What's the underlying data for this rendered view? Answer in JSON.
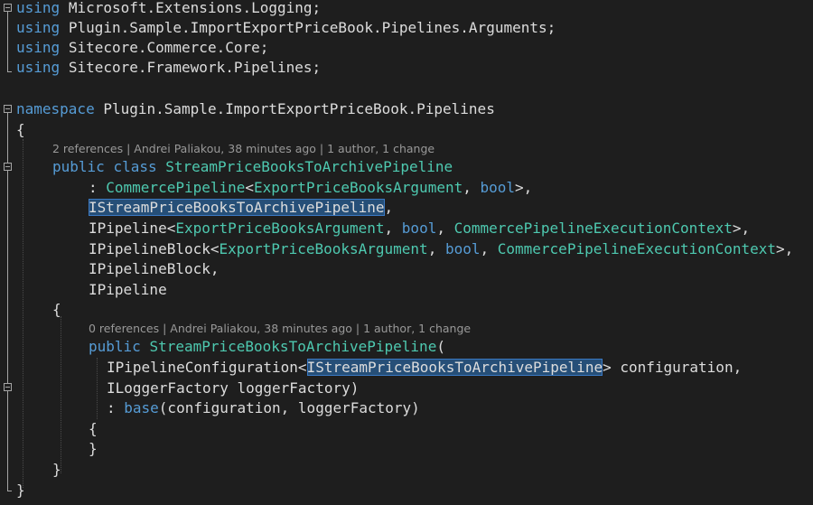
{
  "usings": [
    {
      "keyword": "using",
      "name": "Microsoft.Extensions.Logging",
      "semicolon": ";"
    },
    {
      "keyword": "using",
      "name": "Plugin.Sample.ImportExportPriceBook.Pipelines.Arguments",
      "semicolon": ";"
    },
    {
      "keyword": "using",
      "name": "Sitecore.Commerce.Core",
      "semicolon": ";"
    },
    {
      "keyword": "using",
      "name": "Sitecore.Framework.Pipelines",
      "semicolon": ";"
    }
  ],
  "namespace": {
    "keyword": "namespace",
    "name": "Plugin.Sample.ImportExportPriceBook.Pipelines",
    "open_brace": "{",
    "close_brace": "}"
  },
  "class_lens": "2 references | Andrei Paliakou, 38 minutes ago | 1 author, 1 change",
  "class_decl": {
    "public": "public",
    "class": "class",
    "name": "StreamPriceBooksToArchivePipeline",
    "open_brace": "{",
    "close_brace": "}"
  },
  "bases": {
    "l1_colon": ": ",
    "l1_type": "CommercePipeline",
    "l1_lt": "<",
    "l1_arg": "ExportPriceBooksArgument",
    "l1_sep": ", ",
    "l1_bool": "bool",
    "l1_end": ">,",
    "l2_type": "IStreamPriceBooksToArchivePipeline",
    "l2_end": ",",
    "l3_type": "IPipeline",
    "l3_lt": "<",
    "l3_arg": "ExportPriceBooksArgument",
    "l3_sep": ", ",
    "l3_bool": "bool",
    "l3_sep2": ", ",
    "l3_ctx": "CommercePipelineExecutionContext",
    "l3_end": ">,",
    "l4_type": "IPipelineBlock",
    "l4_lt": "<",
    "l4_arg": "ExportPriceBooksArgument",
    "l4_sep": ", ",
    "l4_bool": "bool",
    "l4_sep2": ", ",
    "l4_ctx": "CommercePipelineExecutionContext",
    "l4_end": ">,",
    "l5_type": "IPipelineBlock",
    "l5_end": ",",
    "l6_type": "IPipeline"
  },
  "ctor_lens": "0 references | Andrei Paliakou, 38 minutes ago | 1 author, 1 change",
  "ctor": {
    "public": "public",
    "name": "StreamPriceBooksToArchivePipeline",
    "open_paren": "(",
    "p1_type": "IPipelineConfiguration",
    "p1_lt": "<",
    "p1_arg": "IStreamPriceBooksToArchivePipeline",
    "p1_rest": "> configuration,",
    "p2": "ILoggerFactory loggerFactory)",
    "base_colon": ": ",
    "base_kw": "base",
    "base_rest": "(configuration, loggerFactory)",
    "open_brace": "{",
    "close_brace": "}"
  }
}
